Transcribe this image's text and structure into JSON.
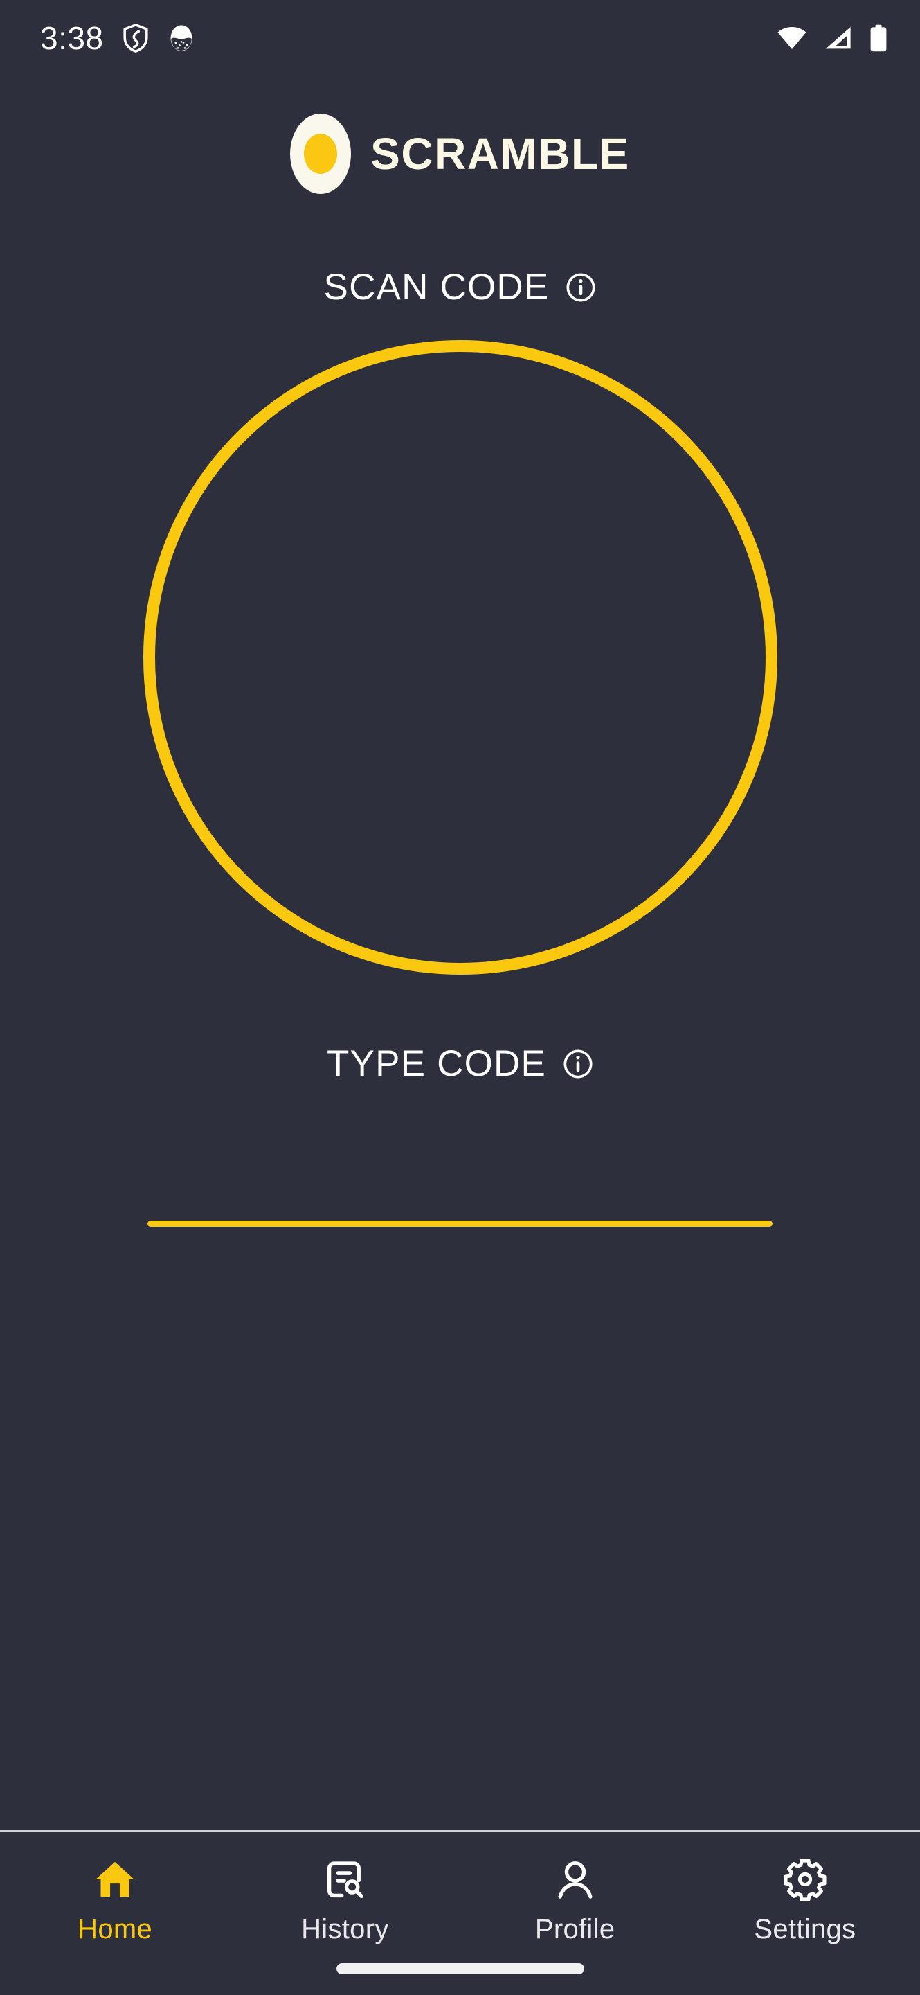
{
  "theme": {
    "background": "#2e2f3c",
    "accent_yellow": "#fac80e",
    "brand_cream": "#fcf8e6",
    "text_white": "#ffffff",
    "divider": "#cfd0d8"
  },
  "status_bar": {
    "time": "3:38",
    "left_icons": [
      "shield-icon",
      "app-notification-icon"
    ],
    "right_icons": [
      "wifi-icon",
      "cellular-signal-icon",
      "battery-icon"
    ]
  },
  "header": {
    "logo_icon": "egg-logo-icon",
    "brand_title": "SCRAMBLE"
  },
  "scan_section": {
    "label": "SCAN CODE",
    "info_icon": "info-icon",
    "viewfinder": "qr-scanner-ring"
  },
  "type_section": {
    "label": "TYPE CODE",
    "info_icon": "info-icon",
    "input_value": "",
    "input_placeholder": ""
  },
  "bottom_nav": {
    "items": [
      {
        "label": "Home",
        "icon": "home-icon",
        "active": true
      },
      {
        "label": "History",
        "icon": "history-icon",
        "active": false
      },
      {
        "label": "Profile",
        "icon": "profile-icon",
        "active": false
      },
      {
        "label": "Settings",
        "icon": "settings-icon",
        "active": false
      }
    ]
  },
  "system": {
    "home_indicator": "home-indicator"
  }
}
